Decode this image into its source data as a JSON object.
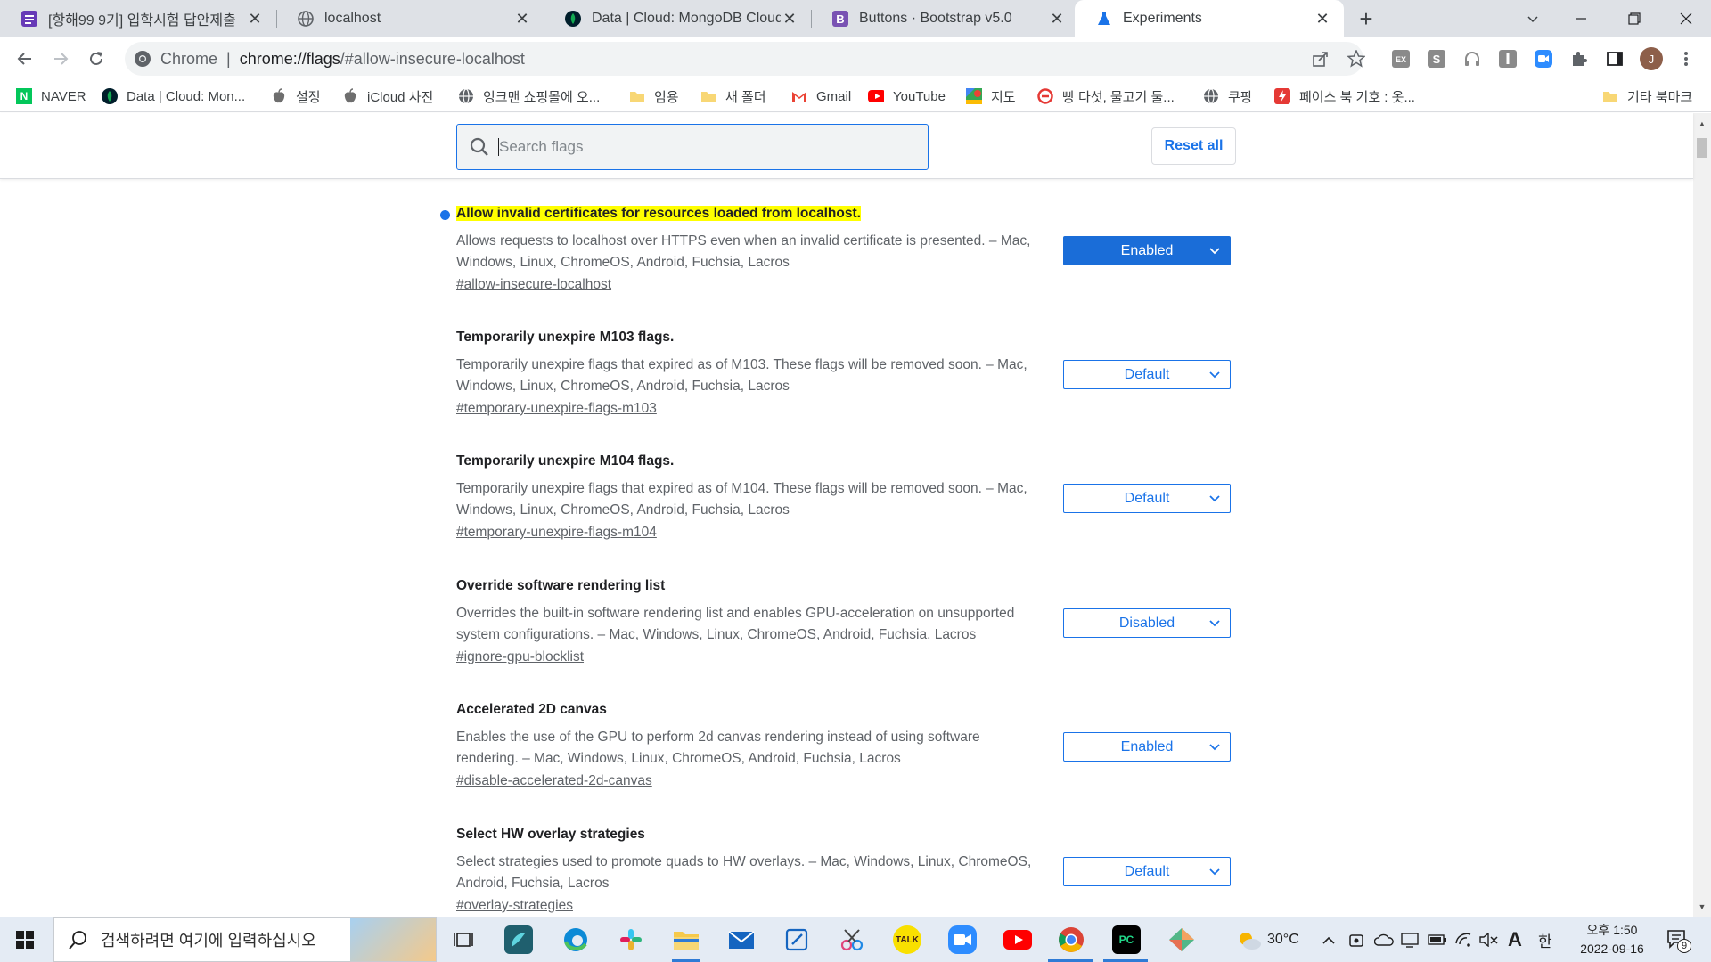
{
  "tabs": [
    {
      "title": "[항해99 9기] 입학시험 답안제출",
      "icon": "form-icon",
      "color": "#673ab7"
    },
    {
      "title": "localhost",
      "icon": "globe-icon",
      "color": "#5f6368"
    },
    {
      "title": "Data | Cloud: MongoDB Cloud",
      "icon": "leaf-icon",
      "color": "#13aa52"
    },
    {
      "title": "Buttons · Bootstrap v5.0",
      "icon": "bootstrap-icon",
      "color": "#7952b3"
    },
    {
      "title": "Experiments",
      "icon": "flask-icon",
      "color": "#1a73e8"
    }
  ],
  "omnibox": {
    "site_label": "Chrome",
    "url_host": "chrome://flags",
    "url_rest": "/#allow-insecure-localhost"
  },
  "profile_initial": "J",
  "bookmarks": [
    {
      "label": "NAVER",
      "icon": "naver-icon"
    },
    {
      "label": "Data | Cloud: Mon...",
      "icon": "leaf-icon"
    },
    {
      "label": "설정",
      "icon": "apple-icon"
    },
    {
      "label": "iCloud 사진",
      "icon": "apple-icon"
    },
    {
      "label": "잉크맨 쇼핑몰에 오...",
      "icon": "globe-icon"
    },
    {
      "label": "임용",
      "icon": "folder-icon"
    },
    {
      "label": "새 폴더",
      "icon": "folder-icon"
    },
    {
      "label": "Gmail",
      "icon": "gmail-icon"
    },
    {
      "label": "YouTube",
      "icon": "youtube-icon"
    },
    {
      "label": "지도",
      "icon": "maps-icon"
    },
    {
      "label": "빵 다섯, 물고기 둘...",
      "icon": "circle-icon"
    },
    {
      "label": "쿠팡",
      "icon": "globe-icon"
    },
    {
      "label": "페이스 북 기호 : 옷...",
      "icon": "bolt-icon"
    },
    {
      "label": "기타 북마크",
      "icon": "folder-icon"
    }
  ],
  "search": {
    "placeholder": "Search flags"
  },
  "reset_label": "Reset all",
  "flags": [
    {
      "title": "Allow invalid certificates for resources loaded from localhost.",
      "highlighted": true,
      "modified": true,
      "description": "Allows requests to localhost over HTTPS even when an invalid certificate is presented. – Mac, Windows, Linux, ChromeOS, Android, Fuchsia, Lacros",
      "link": "#allow-insecure-localhost",
      "value": "Enabled"
    },
    {
      "title": "Temporarily unexpire M103 flags.",
      "highlighted": false,
      "modified": false,
      "description": "Temporarily unexpire flags that expired as of M103. These flags will be removed soon. – Mac, Windows, Linux, ChromeOS, Android, Fuchsia, Lacros",
      "link": "#temporary-unexpire-flags-m103",
      "value": "Default"
    },
    {
      "title": "Temporarily unexpire M104 flags.",
      "highlighted": false,
      "modified": false,
      "description": "Temporarily unexpire flags that expired as of M104. These flags will be removed soon. – Mac, Windows, Linux, ChromeOS, Android, Fuchsia, Lacros",
      "link": "#temporary-unexpire-flags-m104",
      "value": "Default"
    },
    {
      "title": "Override software rendering list",
      "highlighted": false,
      "modified": false,
      "description": "Overrides the built-in software rendering list and enables GPU-acceleration on unsupported system configurations. – Mac, Windows, Linux, ChromeOS, Android, Fuchsia, Lacros",
      "link": "#ignore-gpu-blocklist",
      "value": "Disabled"
    },
    {
      "title": "Accelerated 2D canvas",
      "highlighted": false,
      "modified": false,
      "description": "Enables the use of the GPU to perform 2d canvas rendering instead of using software rendering. – Mac, Windows, Linux, ChromeOS, Android, Fuchsia, Lacros",
      "link": "#disable-accelerated-2d-canvas",
      "value": "Enabled"
    },
    {
      "title": "Select HW overlay strategies",
      "highlighted": false,
      "modified": false,
      "description": "Select strategies used to promote quads to HW overlays. – Mac, Windows, Linux, ChromeOS, Android, Fuchsia, Lacros",
      "link": "#overlay-strategies",
      "value": "Default"
    }
  ],
  "taskbar": {
    "search_placeholder": "검색하려면 여기에 입력하십시오",
    "weather": "30°C",
    "ime": "한",
    "time": "오후 1:50",
    "date": "2022-09-16",
    "notification_count": "9"
  },
  "colors": {
    "accent": "#1a73e8",
    "highlight": "#ffff00",
    "enabled_bg": "#1a6dd8"
  }
}
